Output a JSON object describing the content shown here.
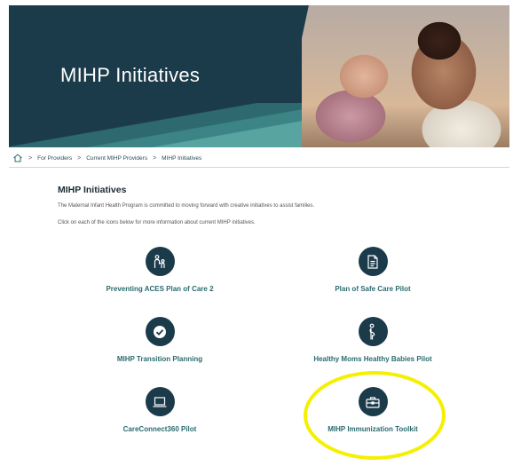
{
  "hero": {
    "title": "MIHP Initiatives"
  },
  "breadcrumb": {
    "items": [
      "For Providers",
      "Current MIHP Providers",
      "MIHP Initiatives"
    ],
    "separator": ">"
  },
  "content": {
    "title": "MIHP Initiatives",
    "paragraph1": "The Maternal Infant Health Program is committed to moving forward with creative initiatives to assist families.",
    "paragraph2": "Click on each of the icons below for more information about current MIHP initiatives."
  },
  "initiatives": [
    {
      "label": "Preventing ACES Plan of Care 2",
      "icon": "parent-child-icon"
    },
    {
      "label": "Plan of Safe Care Pilot",
      "icon": "document-icon"
    },
    {
      "label": "MIHP Transition Planning",
      "icon": "checkmark-icon"
    },
    {
      "label": "Healthy Moms Healthy Babies Pilot",
      "icon": "pregnant-person-icon"
    },
    {
      "label": "CareConnect360 Pilot",
      "icon": "laptop-icon"
    },
    {
      "label": "MIHP Immunization Toolkit",
      "icon": "toolbox-icon"
    }
  ],
  "colors": {
    "navy": "#1b3a4a",
    "teal_text": "#2b6b6f",
    "highlight": "#f4f000"
  }
}
